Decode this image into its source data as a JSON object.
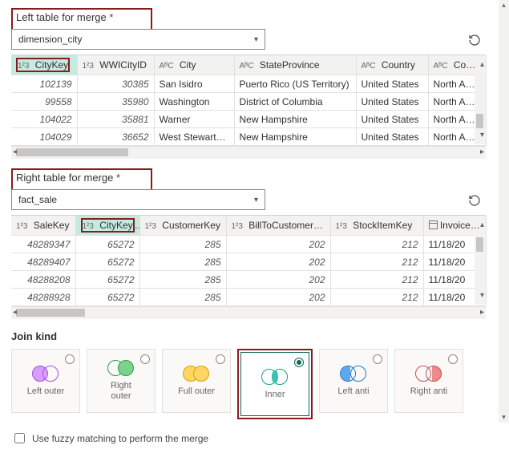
{
  "left": {
    "label": "Left table for merge",
    "required": "*",
    "selected": "dimension_city",
    "columns": [
      {
        "type": "1²3",
        "name": "CityKey",
        "sel": true
      },
      {
        "type": "1²3",
        "name": "WWICityID"
      },
      {
        "type": "AᴮC",
        "name": "City"
      },
      {
        "type": "AᴮC",
        "name": "StateProvince"
      },
      {
        "type": "AᴮC",
        "name": "Country"
      },
      {
        "type": "AᴮC",
        "name": "Continent"
      }
    ],
    "rows": [
      [
        "102139",
        "30385",
        "San Isidro",
        "Puerto Rico (US Territory)",
        "United States",
        "North Amer"
      ],
      [
        "99558",
        "35980",
        "Washington",
        "District of Columbia",
        "United States",
        "North Amer"
      ],
      [
        "104022",
        "35881",
        "Warner",
        "New Hampshire",
        "United States",
        "North Amer"
      ],
      [
        "104029",
        "36652",
        "West Stewartstown",
        "New Hampshire",
        "United States",
        "North Amer"
      ]
    ]
  },
  "right": {
    "label": "Right table for merge",
    "required": "*",
    "selected": "fact_sale",
    "columns": [
      {
        "type": "1²3",
        "name": "SaleKey"
      },
      {
        "type": "1²3",
        "name": "CityKey",
        "sel": true
      },
      {
        "type": "1²3",
        "name": "CustomerKey"
      },
      {
        "type": "1²3",
        "name": "BillToCustomerKey"
      },
      {
        "type": "1²3",
        "name": "StockItemKey"
      },
      {
        "type": "cal",
        "name": "InvoiceDa"
      }
    ],
    "rows": [
      [
        "48289347",
        "65272",
        "285",
        "202",
        "212",
        "11/18/20"
      ],
      [
        "48289407",
        "65272",
        "285",
        "202",
        "212",
        "11/18/20"
      ],
      [
        "48288208",
        "65272",
        "285",
        "202",
        "212",
        "11/18/20"
      ],
      [
        "48288928",
        "65272",
        "285",
        "202",
        "212",
        "11/18/20"
      ]
    ]
  },
  "join": {
    "label": "Join kind",
    "options": [
      {
        "id": "left-outer",
        "label": "Left outer",
        "cls": "lo"
      },
      {
        "id": "right-outer",
        "label": "Right\nouter",
        "cls": "ro"
      },
      {
        "id": "full-outer",
        "label": "Full outer",
        "cls": "fo"
      },
      {
        "id": "inner",
        "label": "Inner",
        "cls": "in",
        "selected": true
      },
      {
        "id": "left-anti",
        "label": "Left anti",
        "cls": "la"
      },
      {
        "id": "right-anti",
        "label": "Right anti",
        "cls": "ra"
      }
    ]
  },
  "fuzzy": {
    "label": "Use fuzzy matching to perform the merge",
    "checked": false
  }
}
